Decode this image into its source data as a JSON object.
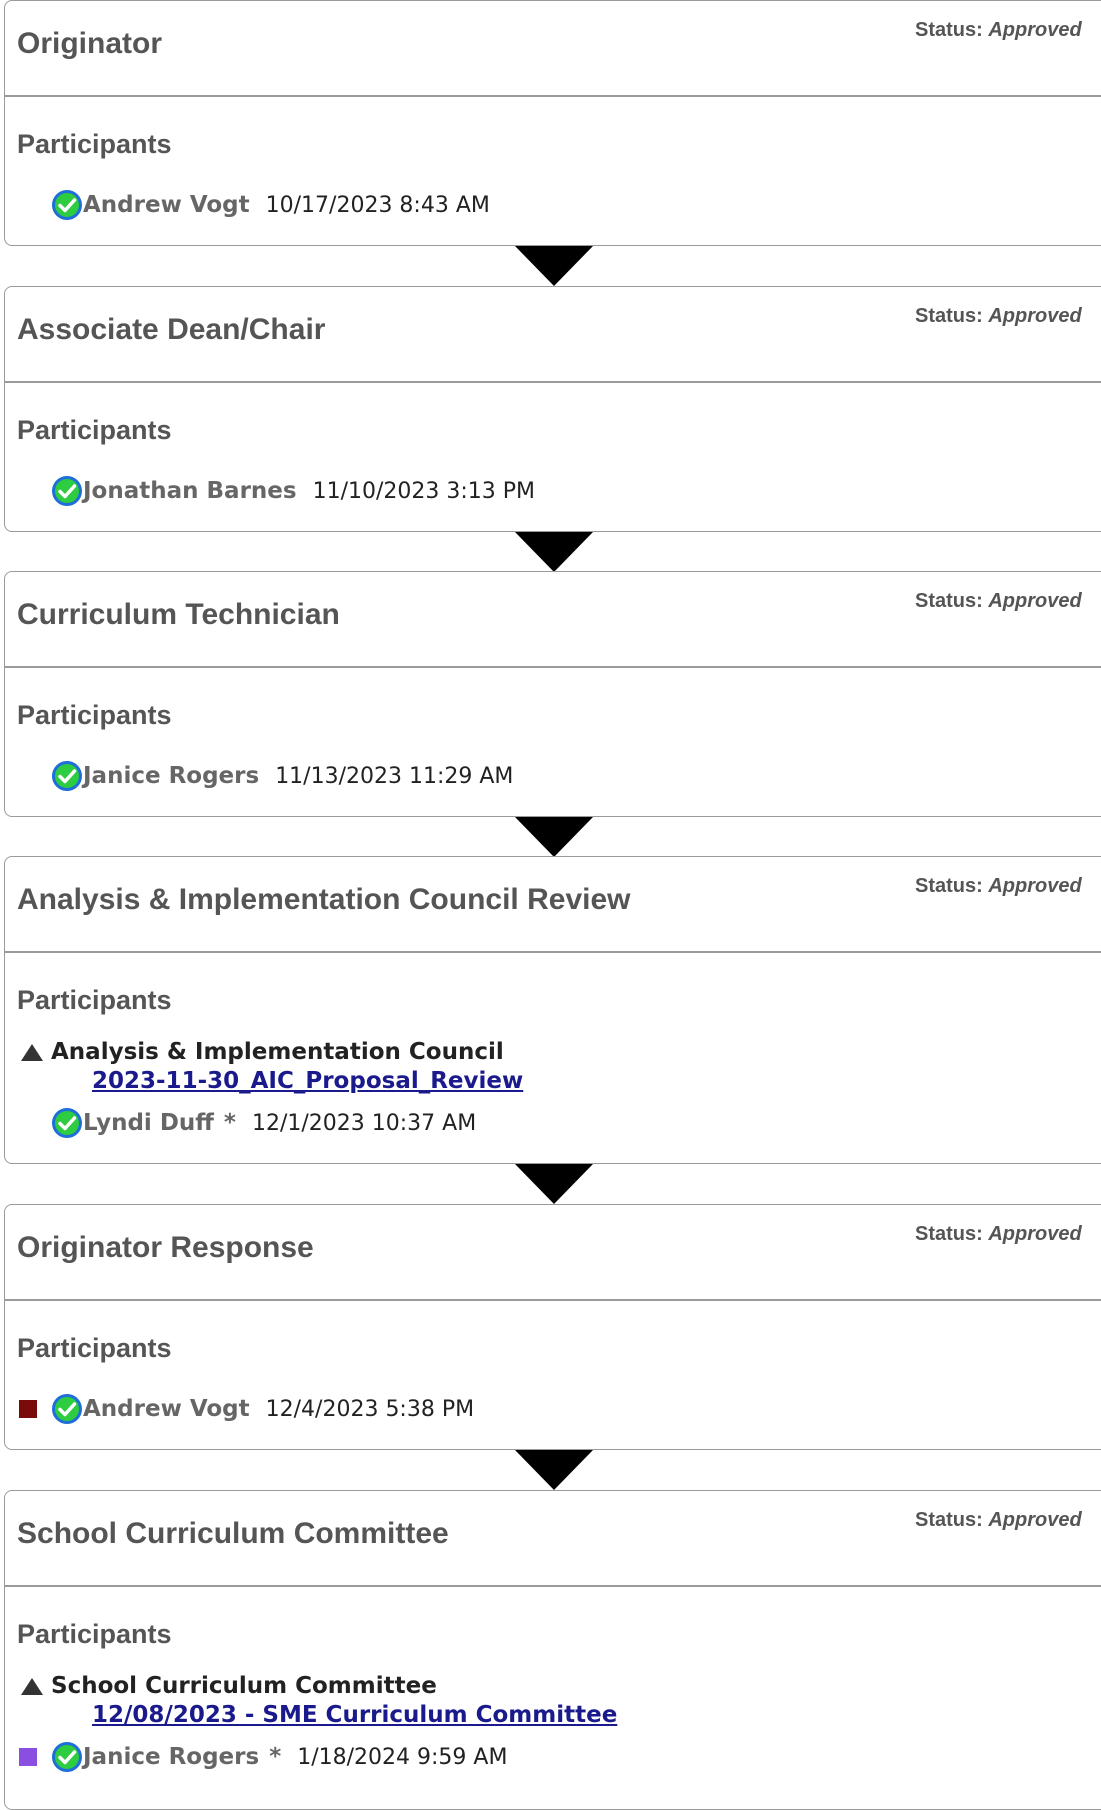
{
  "status_label": "Status:",
  "participants_label": "Participants",
  "steps": [
    {
      "title": "Originator",
      "status": "Approved",
      "participants": [
        {
          "name": "Andrew Vogt",
          "date": "10/17/2023 8:43 AM"
        }
      ]
    },
    {
      "title": "Associate Dean/Chair",
      "status": "Approved",
      "participants": [
        {
          "name": "Jonathan Barnes",
          "date": "11/10/2023 3:13 PM"
        }
      ]
    },
    {
      "title": "Curriculum Technician",
      "status": "Approved",
      "participants": [
        {
          "name": "Janice Rogers",
          "date": "11/13/2023 11:29 AM"
        }
      ]
    },
    {
      "title": "Analysis & Implementation Council Review",
      "status": "Approved",
      "group": {
        "name": "Analysis & Implementation Council",
        "meeting": "2023-11-30_AIC_Proposal_Review"
      },
      "participants": [
        {
          "name": "Lyndi Duff",
          "star": "*",
          "date": "12/1/2023 10:37 AM"
        }
      ]
    },
    {
      "title": "Originator Response",
      "status": "Approved",
      "participants": [
        {
          "name": "Andrew Vogt",
          "date": "12/4/2023 5:38 PM",
          "swatch_color": "#7a0b0b"
        }
      ]
    },
    {
      "title": "School Curriculum Committee",
      "status": "Approved",
      "group": {
        "name": "School Curriculum Committee",
        "meeting": "12/08/2023 - SME Curriculum Committee"
      },
      "participants": [
        {
          "name": "Janice Rogers",
          "star": "*",
          "date": "1/18/2024 9:59 AM",
          "swatch_color": "#8a4fe0"
        }
      ]
    }
  ],
  "colors": {
    "check_fill": "#2ecc40",
    "check_ring": "#1e6fd9",
    "arrow": "#000000",
    "link": "#1a1a8c"
  }
}
